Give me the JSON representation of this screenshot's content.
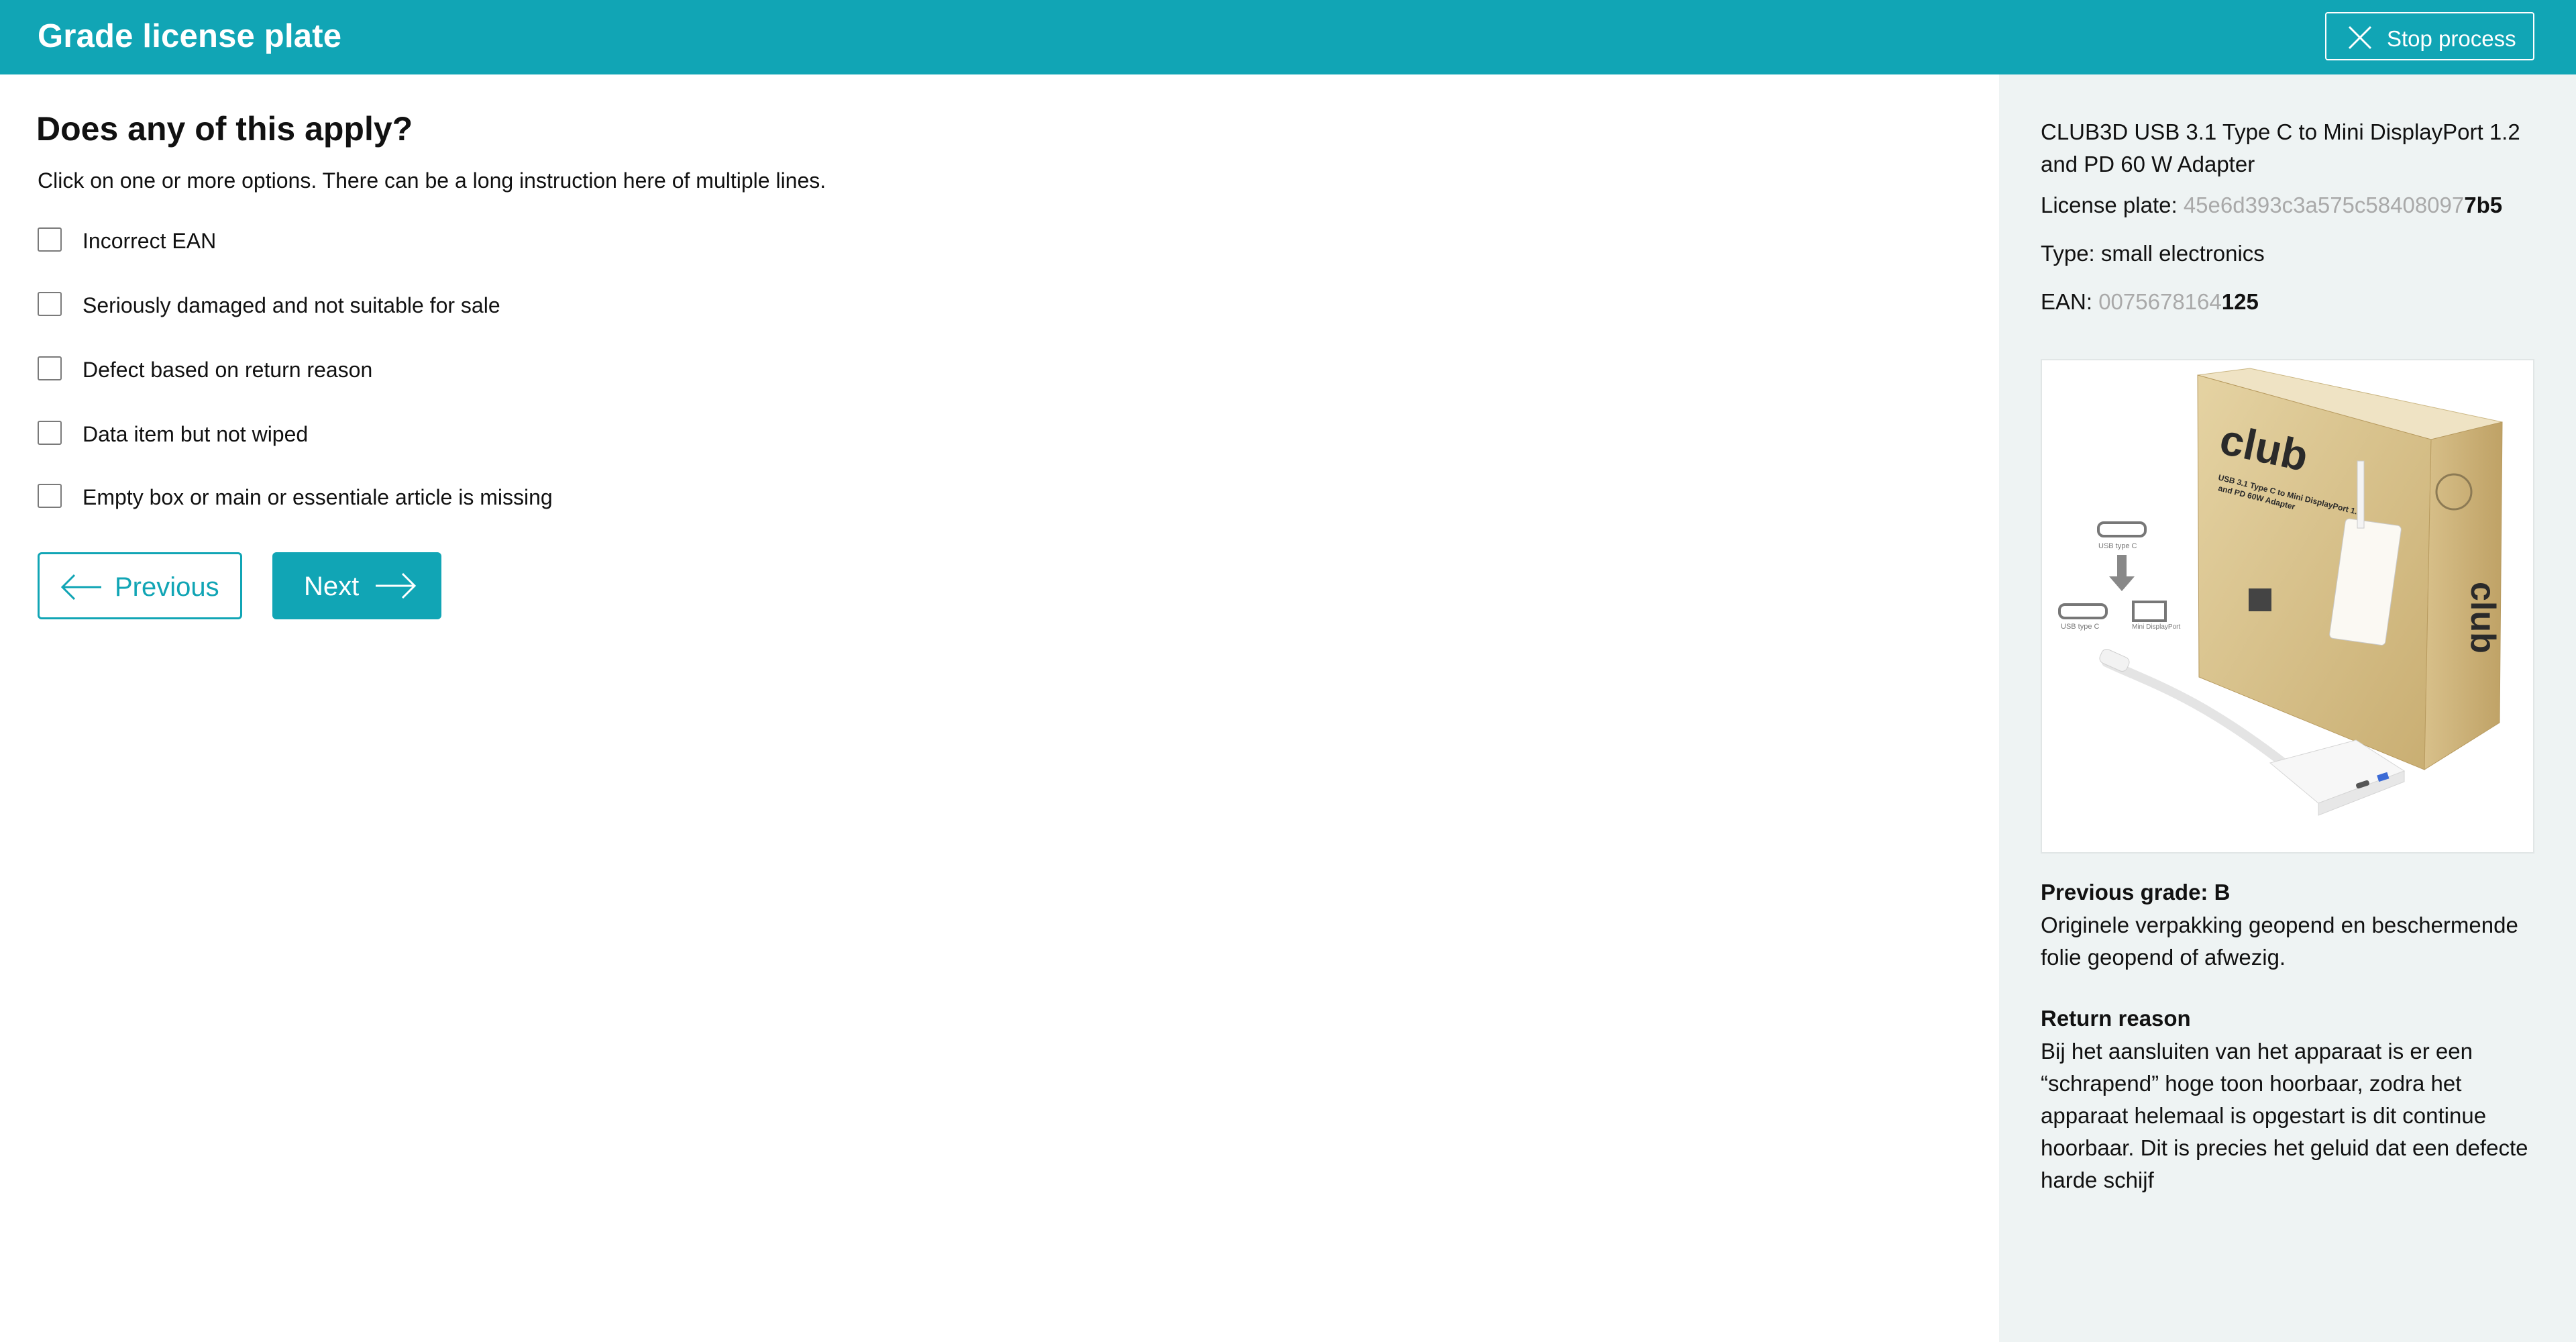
{
  "header": {
    "title": "Grade license plate",
    "stop_label": "Stop process"
  },
  "main": {
    "heading": "Does any of this apply?",
    "instruction": "Click on one or more options. There can be a long instruction here of multiple lines.",
    "options": [
      {
        "label": "Incorrect EAN",
        "checked": false
      },
      {
        "label": "Seriously damaged and not suitable for sale",
        "checked": false
      },
      {
        "label": "Defect based on return reason",
        "checked": false
      },
      {
        "label": "Data item but not wiped",
        "checked": false
      },
      {
        "label": "Empty box or main or essentiale article is missing",
        "checked": false
      }
    ],
    "previous_label": "Previous",
    "next_label": "Next"
  },
  "sidebar": {
    "product_name": "CLUB3D USB 3.1 Type C to Mini DisplayPort 1.2 and PD 60 W Adapter",
    "license_plate": {
      "label": "License plate: ",
      "prefix": "45e6d393c3a575c58408097",
      "suffix": "7b5"
    },
    "type": {
      "label": "Type: ",
      "value": "small electronics"
    },
    "ean": {
      "label": "EAN: ",
      "prefix": "0075678164",
      "suffix": "125"
    },
    "product_image": {
      "box_brand": "club",
      "box_line1": "USB 3.1 Type C to Mini DisplayPort 1.2",
      "box_line2": "and PD 60W Adapter",
      "usb_c_label": "USB type C",
      "usb_c_label_2": "USB type C",
      "mini_dp_label": "Mini DisplayPort"
    },
    "previous_grade": {
      "title": "Previous grade: B",
      "body": "Originele verpakking geopend en beschermende folie geopend of afwezig."
    },
    "return_reason": {
      "title": "Return reason",
      "body": "Bij het aansluiten van het apparaat is er een “schrapend” hoge toon hoorbaar, zodra het apparaat helemaal is opgestart is dit continue hoorbaar. Dit is precies het geluid dat een defecte harde schijf"
    }
  },
  "colors": {
    "accent": "#11a5b5",
    "sidebar_bg": "#eef3f3",
    "muted_text": "#a9a9a9"
  }
}
